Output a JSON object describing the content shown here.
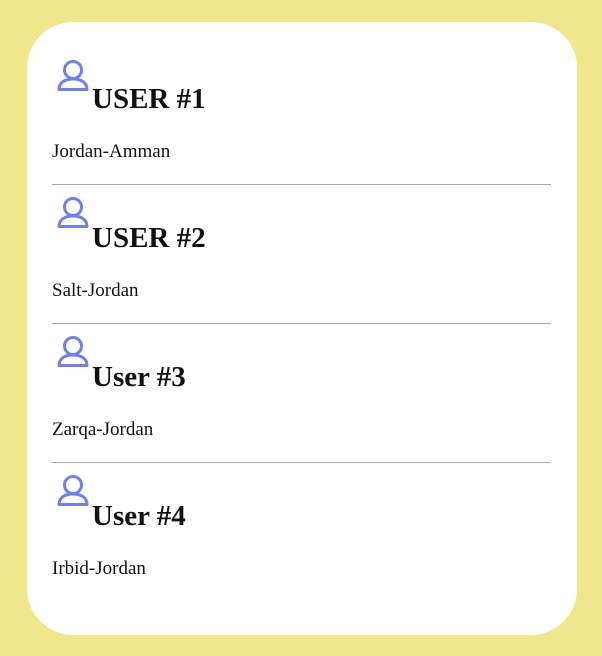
{
  "colors": {
    "page_background": "#f0e68c",
    "card_background": "#ffffff",
    "avatar_stroke": "#6f7ff0",
    "divider": "#a6a6a6"
  },
  "users": [
    {
      "name": "USER #1",
      "location": "Jordan-Amman",
      "icon": "user-avatar-icon"
    },
    {
      "name": "USER #2",
      "location": "Salt-Jordan",
      "icon": "user-avatar-icon"
    },
    {
      "name": "User #3",
      "location": "Zarqa-Jordan",
      "icon": "user-avatar-icon"
    },
    {
      "name": "User #4",
      "location": "Irbid-Jordan",
      "icon": "user-avatar-icon"
    }
  ]
}
